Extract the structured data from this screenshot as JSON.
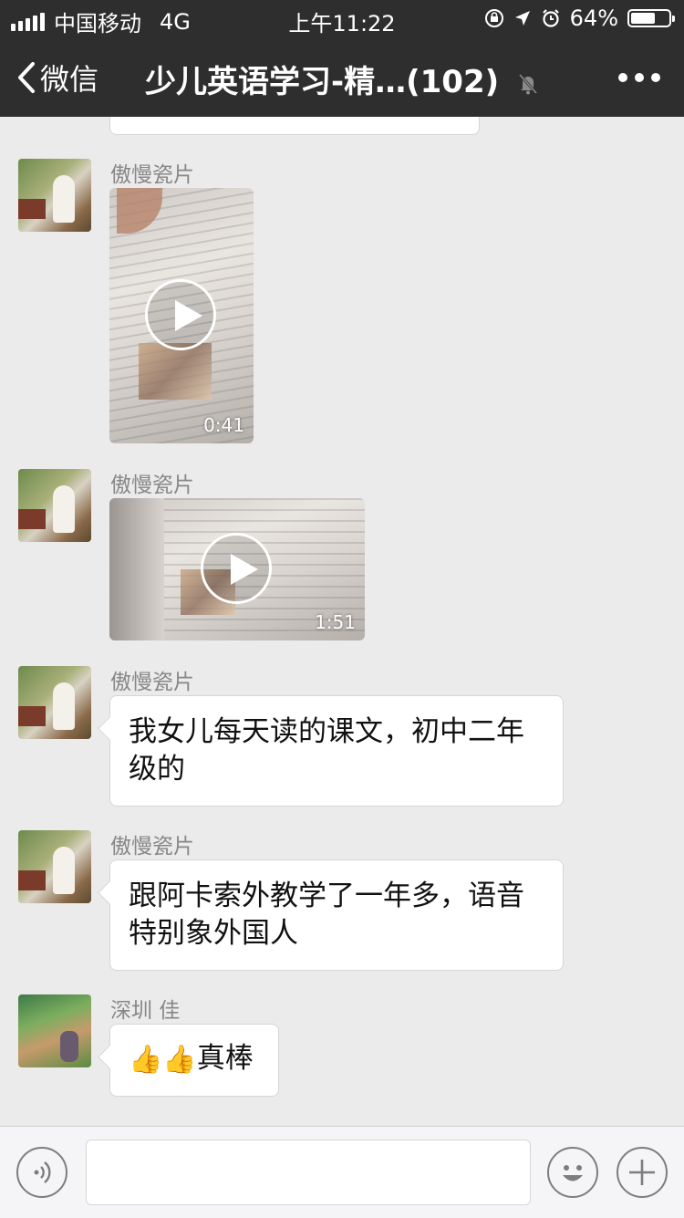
{
  "status_bar": {
    "carrier": "中国移动",
    "network": "4G",
    "time": "上午11:22",
    "battery": "64%",
    "battery_level": 0.64
  },
  "nav": {
    "back_label": "微信",
    "title": "少儿英语学习-精…(102)",
    "muted_icon": "bell-slash-icon",
    "more_icon": "more-icon"
  },
  "messages": [
    {
      "sender": "傲慢瓷片",
      "type": "video",
      "duration": "0:41"
    },
    {
      "sender": "傲慢瓷片",
      "type": "video",
      "duration": "1:51"
    },
    {
      "sender": "傲慢瓷片",
      "type": "text",
      "lines": [
        "我女儿每天读的课文，初中二年",
        "级的"
      ]
    },
    {
      "sender": "傲慢瓷片",
      "type": "text",
      "lines": [
        "跟阿卡索外教学了一年多，语音",
        "特别象外国人"
      ]
    },
    {
      "sender": "深圳 佳",
      "type": "text",
      "emoji": [
        "👍",
        "👍"
      ],
      "text": "真棒"
    }
  ],
  "input_bar": {
    "voice_icon": "voice-icon",
    "emoji_icon": "emoji-icon",
    "plus_icon": "plus-icon"
  }
}
